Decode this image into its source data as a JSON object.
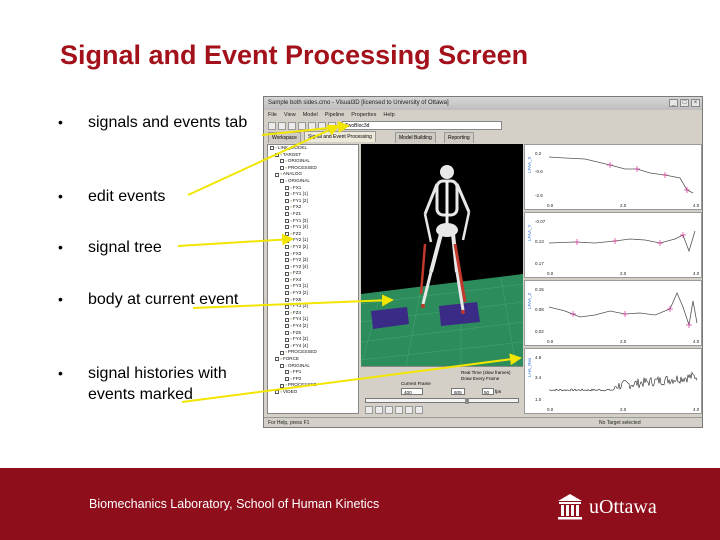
{
  "slide": {
    "title": "Signal and Event Processing Screen",
    "bullets": [
      {
        "marker": "•",
        "text": "signals and events tab"
      },
      {
        "marker": "•",
        "text": "edit events"
      },
      {
        "marker": "•",
        "text": "signal tree"
      },
      {
        "marker": "•",
        "text": "body at current event"
      },
      {
        "marker": "•",
        "text": "signal histories with events marked"
      }
    ]
  },
  "window": {
    "title": "Sample both sides.cmo - Visual3D [licensed to University of Ottawa]",
    "controls": [
      "_",
      "□",
      "×"
    ],
    "menus": [
      "File",
      "View",
      "Model",
      "Pipeline",
      "Properties",
      "Help"
    ],
    "file_field": "TwoBloc3d",
    "tabs": [
      "Workspace",
      "Signal and Event Processing",
      "Model Building",
      "Reporting"
    ],
    "active_tab": "Signal and Event Processing",
    "tree": [
      "LINK_MODEL",
      "TARGET",
      "ORIGINAL",
      "PROCESSED",
      "ANALOG",
      "ORIGINAL",
      "FX1",
      "FY1 [1]",
      "FY1 [2]",
      "FX2",
      "FZ1",
      "FY1 [3]",
      "FY1 [4]",
      "FZ2",
      "FY2 [1]",
      "FY2 [2]",
      "FX3",
      "FY2 [3]",
      "FY2 [4]",
      "FZ3",
      "FX4",
      "FY3 [1]",
      "FY3 [2]",
      "FX5",
      "FY3 [3]",
      "FZ4",
      "FY4 [1]",
      "FY4 [2]",
      "FZ5",
      "FY4 [3]",
      "FY4 [4]",
      "PROCESSED",
      "FORCE",
      "ORIGINAL",
      "FP1",
      "FP2",
      "PROCESSED",
      "VIDEO"
    ],
    "controls_panel": {
      "real_time": "Real Time (slow frames)",
      "draw_every": "Draw Every Frame",
      "current_frame_label": "Current Frame",
      "current_frame": "400",
      "frame_end": "605",
      "speed": "50",
      "fps": "fps"
    },
    "status_left": "For Help, press F1",
    "status_right": "No Target selected"
  },
  "plots": [
    {
      "ylabel": "LFAA_X",
      "yticks": [
        "0.2",
        "-0.6",
        "-2.6"
      ],
      "xticks": [
        "0.0",
        "2.0",
        "4.0"
      ]
    },
    {
      "ylabel": "LFAA_Y",
      "yticks": [
        "-0.07",
        "0.13",
        "0.17"
      ],
      "xticks": [
        "0.0",
        "2.0",
        "4.0"
      ]
    },
    {
      "ylabel": "LFAA_Z",
      "yticks": [
        "0.15",
        "0.08",
        "0.02"
      ],
      "xticks": [
        "0.0",
        "2.0",
        "4.0"
      ]
    },
    {
      "ylabel": "LHA_Res",
      "yticks": [
        "4.8",
        "3.4",
        "1.0"
      ],
      "xticks": [
        "0.0",
        "2.0",
        "4.0"
      ]
    }
  ],
  "footer": {
    "text": "Biomechanics Laboratory, School of Human Kinetics",
    "logo_text": "uOttawa"
  },
  "colors": {
    "title": "#a3111b",
    "footer_bg": "#8f0e1c",
    "arrow": "#f2e600",
    "event_marker": "#cc3399"
  }
}
